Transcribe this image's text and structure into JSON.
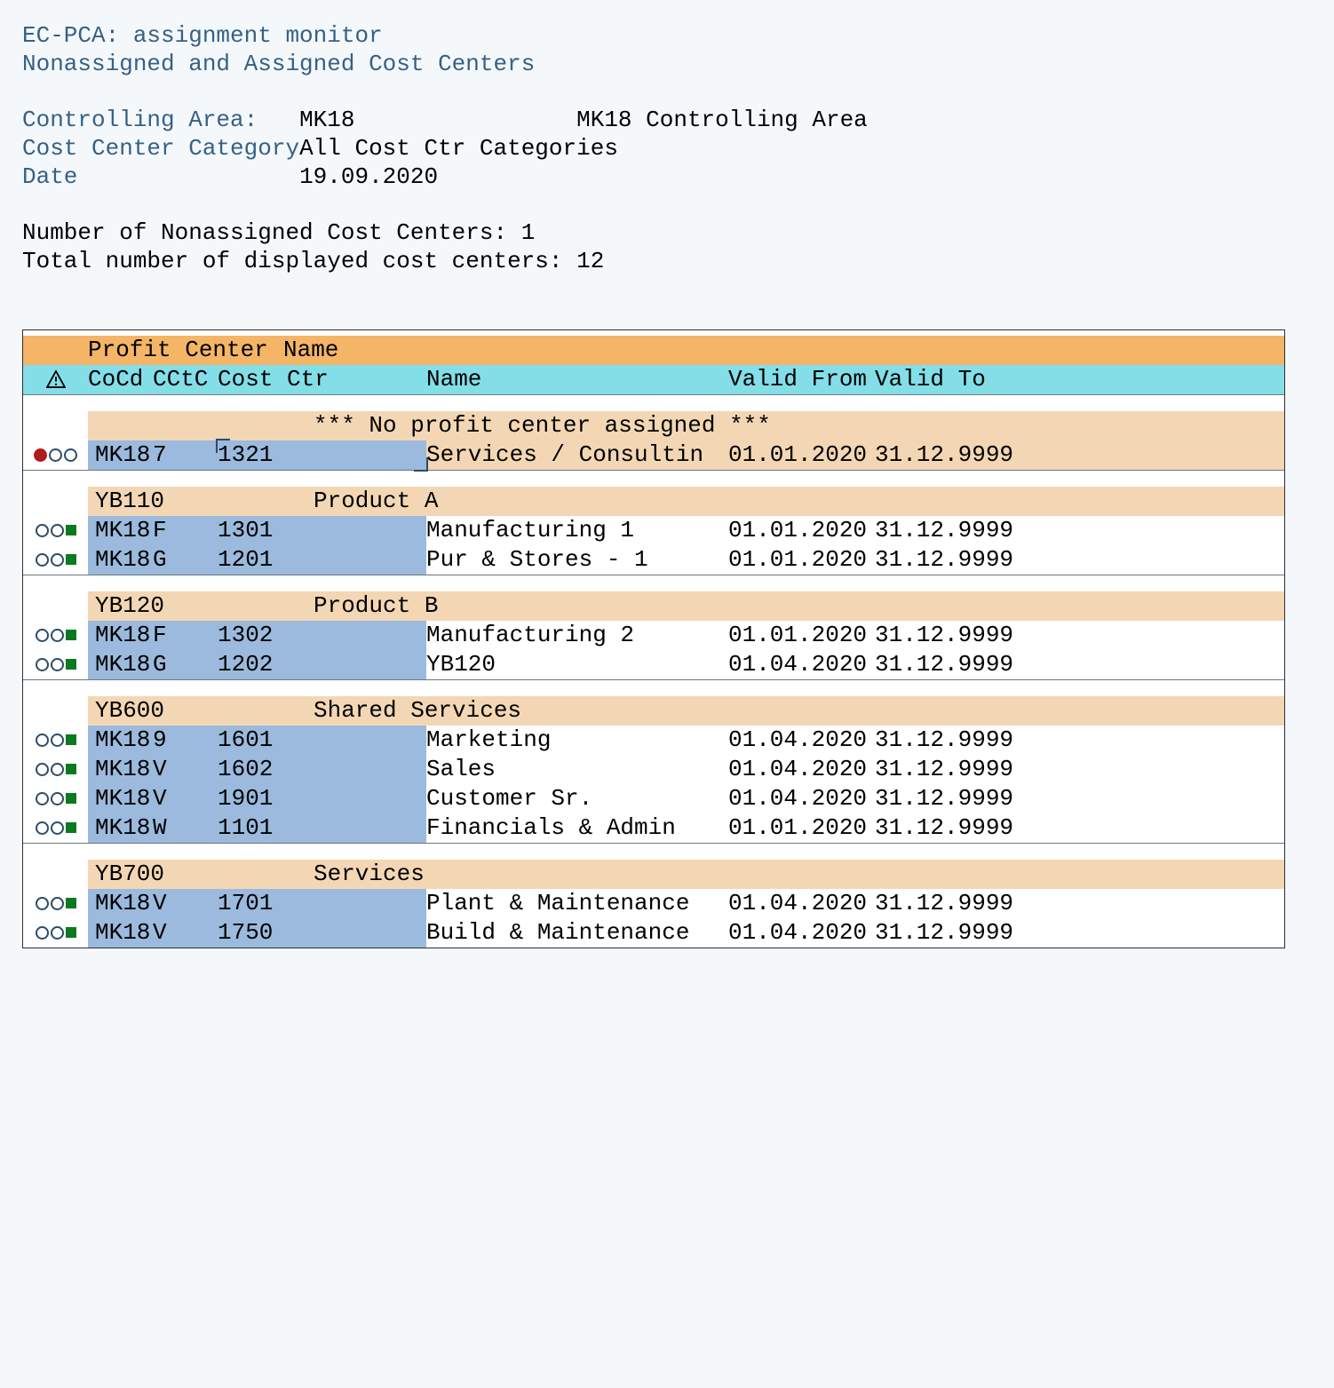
{
  "header": {
    "title1": "EC-PCA: assignment monitor",
    "title2": "Nonassigned and Assigned Cost Centers",
    "controlling_area_label": "Controlling Area:",
    "controlling_area_code": "MK18",
    "controlling_area_desc": "MK18 Controlling Area",
    "cc_category_label": "Cost Center Category",
    "cc_category_value": "All Cost Ctr Categories",
    "date_label": "Date",
    "date_value": "19.09.2020"
  },
  "counts": {
    "nonassigned_label": "Number of Nonassigned Cost Centers:",
    "nonassigned_value": "1",
    "total_label": "Total number of displayed cost centers:",
    "total_value": "12"
  },
  "table_header": {
    "profit_center": "Profit Center",
    "name1": "Name",
    "cocd": "CoCd",
    "cctc": "CCtC",
    "cost_ctr": "Cost Ctr",
    "name2": "Name",
    "valid_from": "Valid From",
    "valid_to": "Valid To"
  },
  "groups": [
    {
      "code": "",
      "name": "*** No profit center assigned ***",
      "no_profit_center": true,
      "rows": [
        {
          "status": "red",
          "cocd": "MK18",
          "cctc": "7",
          "cost": "1321",
          "selected": true,
          "name": "Services / Consultin",
          "from": "01.01.2020",
          "to": "31.12.9999"
        }
      ]
    },
    {
      "code": "YB110",
      "name": "Product A",
      "rows": [
        {
          "status": "green",
          "cocd": "MK18",
          "cctc": "F",
          "cost": "1301",
          "name": "Manufacturing 1",
          "from": "01.01.2020",
          "to": "31.12.9999"
        },
        {
          "status": "green",
          "cocd": "MK18",
          "cctc": "G",
          "cost": "1201",
          "name": "Pur & Stores - 1",
          "from": "01.01.2020",
          "to": "31.12.9999"
        }
      ]
    },
    {
      "code": "YB120",
      "name": "Product B",
      "rows": [
        {
          "status": "green",
          "cocd": "MK18",
          "cctc": "F",
          "cost": "1302",
          "name": "Manufacturing 2",
          "from": "01.01.2020",
          "to": "31.12.9999"
        },
        {
          "status": "green",
          "cocd": "MK18",
          "cctc": "G",
          "cost": "1202",
          "name": "YB120",
          "from": "01.04.2020",
          "to": "31.12.9999"
        }
      ]
    },
    {
      "code": "YB600",
      "name": "Shared Services",
      "rows": [
        {
          "status": "green",
          "cocd": "MK18",
          "cctc": "9",
          "cost": "1601",
          "name": "Marketing",
          "from": "01.04.2020",
          "to": "31.12.9999"
        },
        {
          "status": "green",
          "cocd": "MK18",
          "cctc": "V",
          "cost": "1602",
          "name": "Sales",
          "from": "01.04.2020",
          "to": "31.12.9999"
        },
        {
          "status": "green",
          "cocd": "MK18",
          "cctc": "V",
          "cost": "1901",
          "name": "Customer Sr.",
          "from": "01.04.2020",
          "to": "31.12.9999"
        },
        {
          "status": "green",
          "cocd": "MK18",
          "cctc": "W",
          "cost": "1101",
          "name": "Financials & Admin",
          "from": "01.01.2020",
          "to": "31.12.9999"
        }
      ]
    },
    {
      "code": "YB700",
      "name": "Services",
      "rows": [
        {
          "status": "green",
          "cocd": "MK18",
          "cctc": "V",
          "cost": "1701",
          "name": "Plant & Maintenance",
          "from": "01.04.2020",
          "to": "31.12.9999"
        },
        {
          "status": "green",
          "cocd": "MK18",
          "cctc": "V",
          "cost": "1750",
          "name": "Build & Maintenance",
          "from": "01.04.2020",
          "to": "31.12.9999"
        }
      ]
    }
  ]
}
